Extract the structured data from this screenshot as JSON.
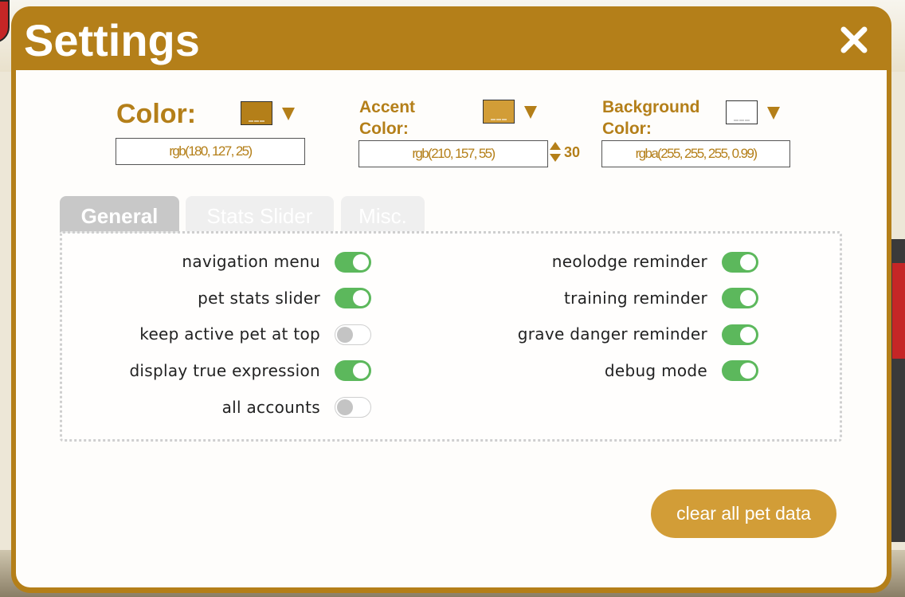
{
  "modal": {
    "title": "Settings"
  },
  "colors": {
    "primary": {
      "label": "Color:",
      "value": "rgb(180, 127, 25)",
      "swatch": "#b47f19"
    },
    "accent": {
      "label_line1": "Accent",
      "label_line2": "Color:",
      "value": "rgb(210, 157, 55)",
      "swatch": "#d29d37",
      "spinner_value": "30"
    },
    "background": {
      "label_line1": "Background",
      "label_line2": "Color:",
      "value": "rgba(255, 255, 255, 0.99)",
      "swatch": "#ffffff"
    }
  },
  "tabs": [
    {
      "label": "General",
      "active": true
    },
    {
      "label": "Stats Slider",
      "active": false
    },
    {
      "label": "Misc.",
      "active": false
    }
  ],
  "general_options": {
    "left": [
      {
        "label": "navigation menu",
        "enabled": true
      },
      {
        "label": "pet stats slider",
        "enabled": true
      },
      {
        "label": "keep active pet at top",
        "enabled": false
      },
      {
        "label": "display true expression",
        "enabled": true
      },
      {
        "label": "all accounts",
        "enabled": false
      }
    ],
    "right": [
      {
        "label": "neolodge reminder",
        "enabled": true
      },
      {
        "label": "training reminder",
        "enabled": true
      },
      {
        "label": "grave danger reminder",
        "enabled": true
      },
      {
        "label": "debug mode",
        "enabled": true
      }
    ]
  },
  "actions": {
    "clear_label": "clear all pet data"
  },
  "icons": {
    "close": "close-icon",
    "dropdown": "caret-down-icon",
    "spinner": "spinner-icon"
  },
  "theme": {
    "accent": "#b47f19",
    "accent_light": "#d29d37",
    "toggle_on": "#5cb85c",
    "toggle_off": "#c4c4c4"
  }
}
